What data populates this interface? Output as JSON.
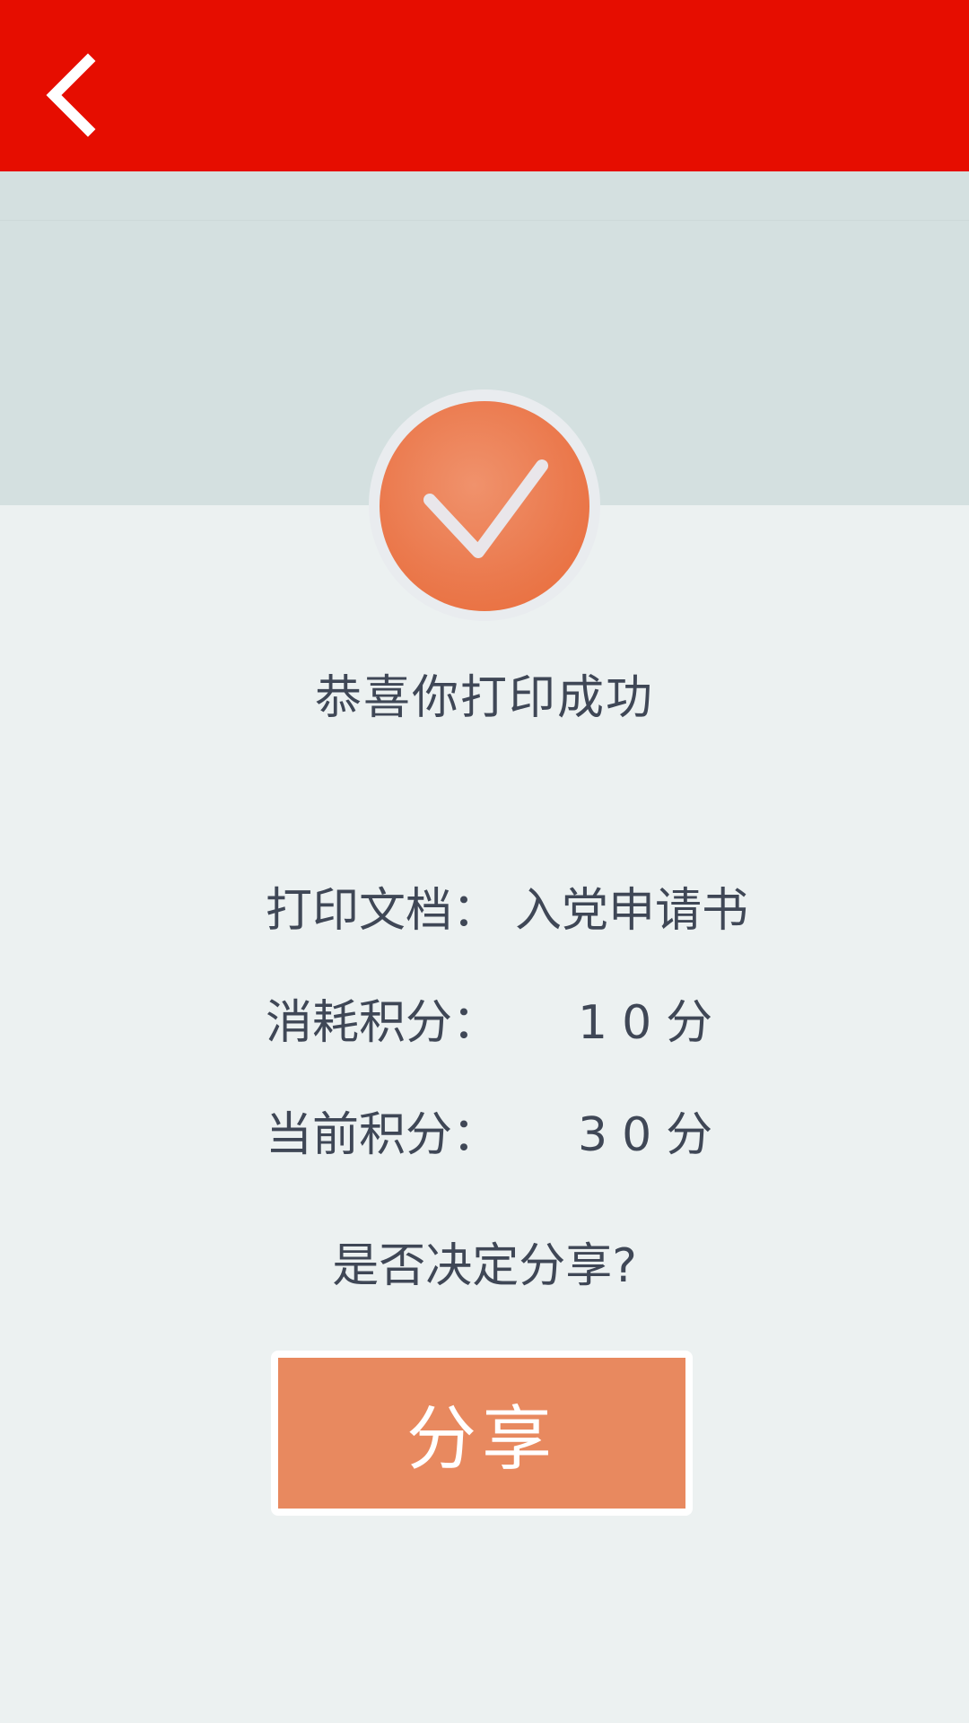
{
  "header": {
    "back_icon": "chevron-left-icon",
    "color": "#e60d00"
  },
  "status": {
    "icon": "checkmark-icon",
    "accent": "#eb7a4e"
  },
  "message": {
    "title": "恭喜你打印成功"
  },
  "details": [
    {
      "label": "打印文档：",
      "value": "入党申请书"
    },
    {
      "label": "消耗积分：",
      "value": "10分"
    },
    {
      "label": "当前积分：",
      "value": "30分"
    }
  ],
  "share": {
    "question": "是否决定分享?",
    "button_label": "分享"
  }
}
